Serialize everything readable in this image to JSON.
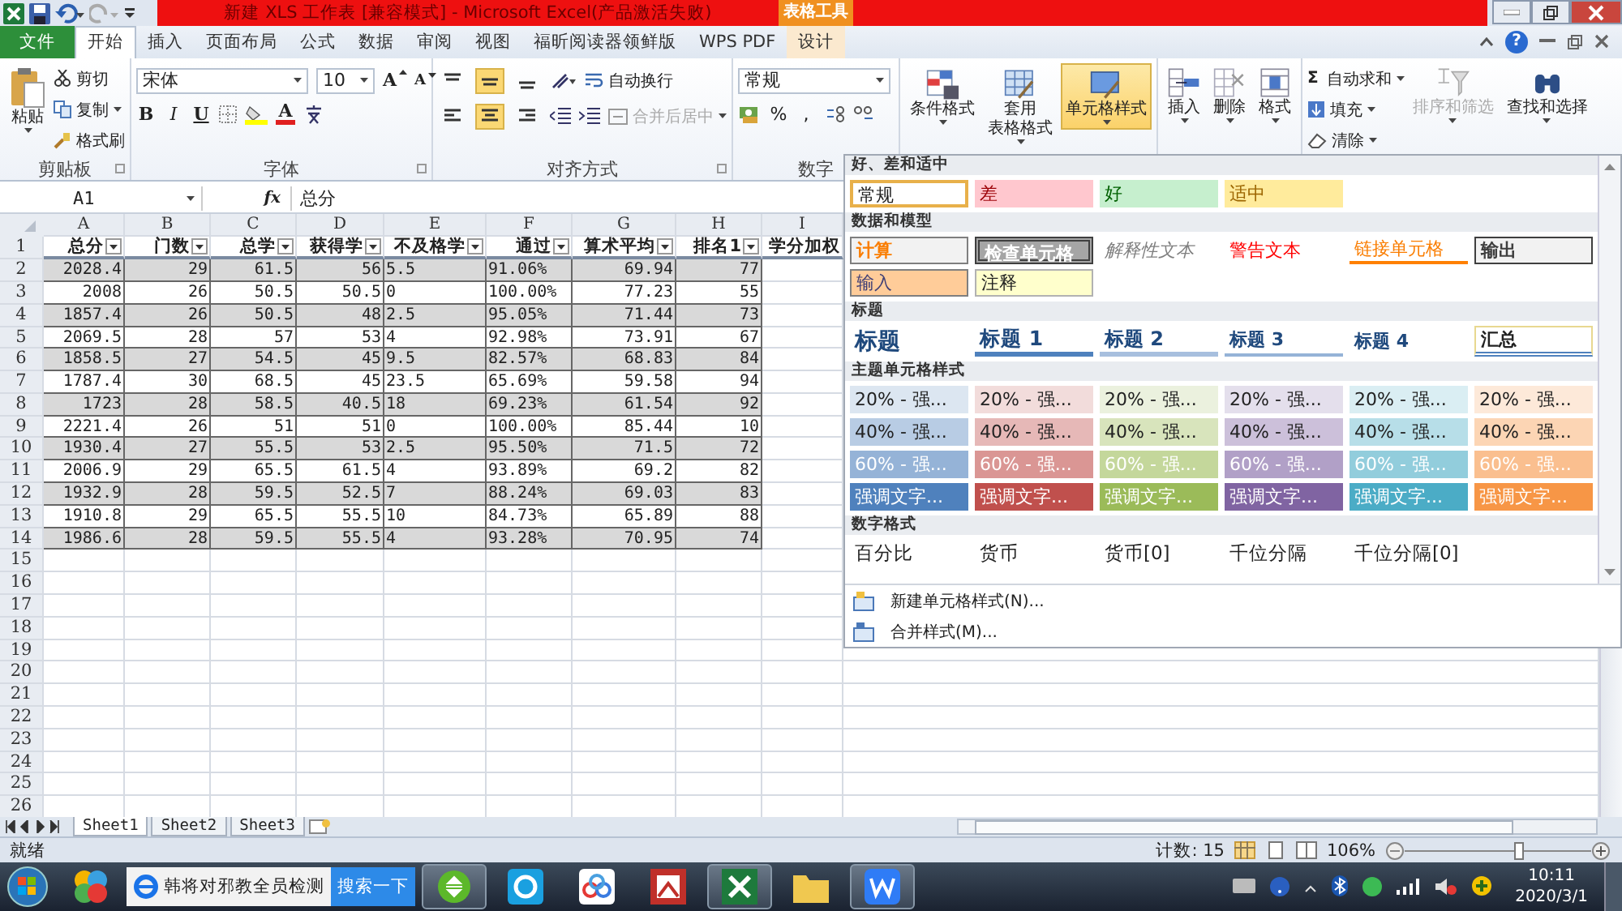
{
  "title_bar": {
    "title": "新建 XLS 工作表 [兼容模式] - Microsoft Excel(产品激活失败)",
    "context_label": "表格工具"
  },
  "ribbon_tabs": [
    {
      "label": "文件",
      "kind": "file",
      "selected": false
    },
    {
      "label": "开始",
      "kind": "tab",
      "selected": true
    },
    {
      "label": "插入",
      "kind": "tab",
      "selected": false
    },
    {
      "label": "页面布局",
      "kind": "tab",
      "selected": false
    },
    {
      "label": "公式",
      "kind": "tab",
      "selected": false
    },
    {
      "label": "数据",
      "kind": "tab",
      "selected": false
    },
    {
      "label": "审阅",
      "kind": "tab",
      "selected": false
    },
    {
      "label": "视图",
      "kind": "tab",
      "selected": false
    },
    {
      "label": "福昕阅读器领鲜版",
      "kind": "tab",
      "selected": false
    },
    {
      "label": "WPS PDF",
      "kind": "tab",
      "selected": false
    },
    {
      "label": "设计",
      "kind": "context",
      "selected": false
    }
  ],
  "help": "?",
  "clipboard": {
    "group": "剪贴板",
    "paste": "粘贴",
    "cut": "剪切",
    "copy": "复制",
    "format_painter": "格式刷"
  },
  "font": {
    "group": "字体",
    "name": "宋体",
    "size": "10",
    "grow": "A",
    "shrink": "A",
    "bold": "B",
    "italic": "I",
    "underline": "U",
    "color_letter": "A"
  },
  "alignment": {
    "group": "对齐方式",
    "vertical": [
      {
        "on": false
      },
      {
        "on": true
      },
      {
        "on": false
      }
    ],
    "horizontal": [
      {
        "on": false
      },
      {
        "on": true
      },
      {
        "on": false
      }
    ],
    "wrap": "自动换行",
    "merge": {
      "label": "合并后居中",
      "disabled": true
    }
  },
  "number": {
    "group": "数字",
    "format": "常规",
    "percent": "%",
    "comma": ","
  },
  "style_buttons": [
    {
      "lines": [
        "条件格式"
      ],
      "kind": "conditional",
      "selected": false
    },
    {
      "lines": [
        "套用",
        "表格格式"
      ],
      "kind": "table",
      "selected": false
    },
    {
      "lines": [
        "单元格样式"
      ],
      "kind": "cell",
      "selected": true
    }
  ],
  "cell_buttons": [
    {
      "label": "插入",
      "kind": "insert"
    },
    {
      "label": "删除",
      "kind": "delete"
    },
    {
      "label": "格式",
      "kind": "format"
    }
  ],
  "editing": {
    "autosum_symbol": "Σ",
    "autosum": "自动求和",
    "fill": "填充",
    "clear": "清除",
    "sort": {
      "label": "排序和筛选",
      "disabled": true
    },
    "find": "查找和选择"
  },
  "formula_bar": {
    "name_box": "A1",
    "fx": "fx",
    "value": "总分"
  },
  "sheet": {
    "header_row_number": "1",
    "columns": [
      {
        "letter": "A",
        "header": "总分",
        "kind": "number",
        "filter": true
      },
      {
        "letter": "B",
        "header": "门数",
        "kind": "number",
        "filter": true
      },
      {
        "letter": "C",
        "header": "总学",
        "kind": "number",
        "filter": true
      },
      {
        "letter": "D",
        "header": "获得学",
        "kind": "number",
        "filter": true
      },
      {
        "letter": "E",
        "header": "不及格学",
        "kind": "text",
        "filter": true
      },
      {
        "letter": "F",
        "header": "通过",
        "kind": "text",
        "filter": true
      },
      {
        "letter": "G",
        "header": "算术平均",
        "kind": "number",
        "filter": true
      },
      {
        "letter": "H",
        "header": "排名1",
        "kind": "number",
        "filter": true
      },
      {
        "letter": "I",
        "header": "学分加权",
        "kind": "number",
        "filter": false
      }
    ],
    "rows": [
      {
        "number": "2",
        "cells": [
          "2028.4",
          "29",
          "61.5",
          "56",
          "5.5",
          "91.06%",
          "69.94",
          "77"
        ]
      },
      {
        "number": "3",
        "cells": [
          "2008",
          "26",
          "50.5",
          "50.5",
          "0",
          "100.00%",
          "77.23",
          "55"
        ]
      },
      {
        "number": "4",
        "cells": [
          "1857.4",
          "26",
          "50.5",
          "48",
          "2.5",
          "95.05%",
          "71.44",
          "73"
        ]
      },
      {
        "number": "5",
        "cells": [
          "2069.5",
          "28",
          "57",
          "53",
          "4",
          "92.98%",
          "73.91",
          "67"
        ]
      },
      {
        "number": "6",
        "cells": [
          "1858.5",
          "27",
          "54.5",
          "45",
          "9.5",
          "82.57%",
          "68.83",
          "84"
        ]
      },
      {
        "number": "7",
        "cells": [
          "1787.4",
          "30",
          "68.5",
          "45",
          "23.5",
          "65.69%",
          "59.58",
          "94"
        ]
      },
      {
        "number": "8",
        "cells": [
          "1723",
          "28",
          "58.5",
          "40.5",
          "18",
          "69.23%",
          "61.54",
          "92"
        ]
      },
      {
        "number": "9",
        "cells": [
          "2221.4",
          "26",
          "51",
          "51",
          "0",
          "100.00%",
          "85.44",
          "10"
        ]
      },
      {
        "number": "10",
        "cells": [
          "1930.4",
          "27",
          "55.5",
          "53",
          "2.5",
          "95.50%",
          "71.5",
          "72"
        ]
      },
      {
        "number": "11",
        "cells": [
          "2006.9",
          "29",
          "65.5",
          "61.5",
          "4",
          "93.89%",
          "69.2",
          "82"
        ]
      },
      {
        "number": "12",
        "cells": [
          "1932.9",
          "28",
          "59.5",
          "52.5",
          "7",
          "88.24%",
          "69.03",
          "83"
        ]
      },
      {
        "number": "13",
        "cells": [
          "1910.8",
          "29",
          "65.5",
          "55.5",
          "10",
          "84.73%",
          "65.89",
          "88"
        ]
      },
      {
        "number": "14",
        "cells": [
          "1986.6",
          "28",
          "59.5",
          "55.5",
          "4",
          "93.28%",
          "70.95",
          "74"
        ]
      }
    ],
    "empty_rows": [
      "15",
      "16",
      "17",
      "18",
      "19",
      "20",
      "21",
      "22",
      "23",
      "24",
      "25",
      "26"
    ]
  },
  "sheet_tabs": [
    {
      "label": "Sheet1",
      "selected": true
    },
    {
      "label": "Sheet2",
      "selected": false
    },
    {
      "label": "Sheet3",
      "selected": false
    }
  ],
  "status_bar": {
    "ready": "就绪",
    "count": "计数: 15",
    "zoom": "106%"
  },
  "style_gallery": {
    "sections": [
      {
        "title": "好、差和适中",
        "items": [
          {
            "label": "常规",
            "kind": "normal",
            "selected": true
          },
          {
            "label": "差",
            "kind": "bad",
            "selected": false
          },
          {
            "label": "好",
            "kind": "good",
            "selected": false
          },
          {
            "label": "适中",
            "kind": "neutral",
            "selected": false
          }
        ]
      },
      {
        "title": "数据和模型",
        "items": [
          {
            "label": "计算",
            "kind": "calculation",
            "selected": false
          },
          {
            "label": "检查单元格",
            "kind": "check",
            "selected": false
          },
          {
            "label": "解释性文本",
            "kind": "explanatory",
            "selected": false
          },
          {
            "label": "警告文本",
            "kind": "warning",
            "selected": false
          },
          {
            "label": "链接单元格",
            "kind": "linked",
            "selected": false
          },
          {
            "label": "输出",
            "kind": "output",
            "selected": false
          },
          {
            "label": "输入",
            "kind": "input",
            "selected": false
          },
          {
            "label": "注释",
            "kind": "note",
            "selected": false
          }
        ]
      },
      {
        "title": "标题",
        "items": [
          {
            "label": "标题",
            "kind": "title",
            "selected": false
          },
          {
            "label": "标题 1",
            "kind": "heading1",
            "selected": false
          },
          {
            "label": "标题 2",
            "kind": "heading2",
            "selected": false
          },
          {
            "label": "标题 3",
            "kind": "heading3",
            "selected": false
          },
          {
            "label": "标题 4",
            "kind": "heading4",
            "selected": false
          },
          {
            "label": "汇总",
            "kind": "total",
            "selected": false
          }
        ]
      },
      {
        "title": "主题单元格样式",
        "items": [
          {
            "label": "20% - 强...",
            "kind": "light",
            "color": "#dce6f1",
            "selected": false
          },
          {
            "label": "20% - 强...",
            "kind": "light",
            "color": "#f2dcdb",
            "selected": false
          },
          {
            "label": "20% - 强...",
            "kind": "light",
            "color": "#ebf1de",
            "selected": false
          },
          {
            "label": "20% - 强...",
            "kind": "light",
            "color": "#e4dfec",
            "selected": false
          },
          {
            "label": "20% - 强...",
            "kind": "light",
            "color": "#daeef3",
            "selected": false
          },
          {
            "label": "20% - 强...",
            "kind": "light",
            "color": "#fde9d9",
            "selected": false
          },
          {
            "label": "40% - 强...",
            "kind": "light",
            "color": "#b8cce4",
            "selected": false
          },
          {
            "label": "40% - 强...",
            "kind": "light",
            "color": "#e6b8b7",
            "selected": false
          },
          {
            "label": "40% - 强...",
            "kind": "light",
            "color": "#d8e4bc",
            "selected": false
          },
          {
            "label": "40% - 强...",
            "kind": "light",
            "color": "#ccc0da",
            "selected": false
          },
          {
            "label": "40% - 强...",
            "kind": "light",
            "color": "#b7dee8",
            "selected": false
          },
          {
            "label": "40% - 强...",
            "kind": "light",
            "color": "#fcd5b4",
            "selected": false
          },
          {
            "label": "60% - 强...",
            "kind": "dark",
            "color": "#95b3d7",
            "selected": false
          },
          {
            "label": "60% - 强...",
            "kind": "dark",
            "color": "#da9694",
            "selected": false
          },
          {
            "label": "60% - 强...",
            "kind": "dark",
            "color": "#c4d79b",
            "selected": false
          },
          {
            "label": "60% - 强...",
            "kind": "dark",
            "color": "#b1a0c7",
            "selected": false
          },
          {
            "label": "60% - 强...",
            "kind": "dark",
            "color": "#92cddc",
            "selected": false
          },
          {
            "label": "60% - 强...",
            "kind": "dark",
            "color": "#fabf8f",
            "selected": false
          },
          {
            "label": "强调文字...",
            "kind": "dark",
            "color": "#4f81bd",
            "selected": false
          },
          {
            "label": "强调文字...",
            "kind": "dark",
            "color": "#c0504d",
            "selected": false
          },
          {
            "label": "强调文字...",
            "kind": "dark",
            "color": "#9bbb59",
            "selected": false
          },
          {
            "label": "强调文字...",
            "kind": "dark",
            "color": "#8064a2",
            "selected": false
          },
          {
            "label": "强调文字...",
            "kind": "dark",
            "color": "#4bacc6",
            "selected": false
          },
          {
            "label": "强调文字...",
            "kind": "dark",
            "color": "#f79646",
            "selected": false
          }
        ]
      },
      {
        "title": "数字格式",
        "items": [
          {
            "label": "百分比",
            "kind": "number",
            "selected": false
          },
          {
            "label": "货币",
            "kind": "number",
            "selected": false
          },
          {
            "label": "货币[0]",
            "kind": "number",
            "selected": false
          },
          {
            "label": "千位分隔",
            "kind": "number",
            "selected": false
          },
          {
            "label": "千位分隔[0]",
            "kind": "number",
            "selected": false
          }
        ]
      }
    ],
    "commands": [
      "新建单元格样式(N)...",
      "合并样式(M)..."
    ]
  },
  "taskbar": {
    "search_text": "韩将对邪教全员检测",
    "search_button": "搜索一下",
    "time": "10:11",
    "date": "2020/3/1"
  }
}
